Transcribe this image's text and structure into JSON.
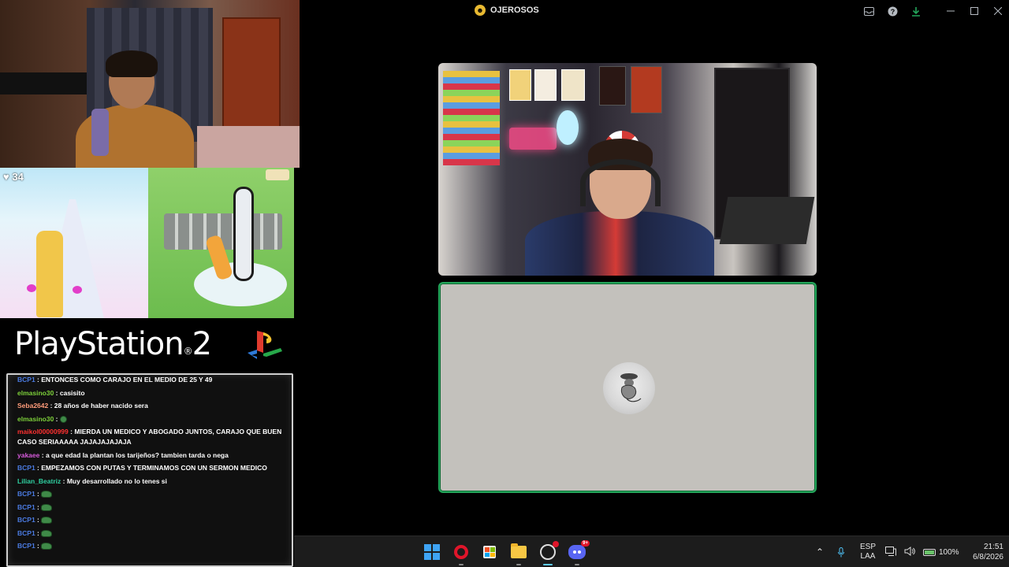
{
  "window": {
    "title": "OJEROSOS",
    "server_icon": "emoji-server-icon"
  },
  "titlebar_icons": [
    "inbox-icon",
    "help-icon",
    "download-icon",
    "minimize-icon",
    "maximize-icon",
    "close-icon"
  ],
  "overlay": {
    "game_score": "34",
    "ps2_logo": "PlayStation",
    "ps2_logo_suffix": "2"
  },
  "chat": {
    "messages": [
      {
        "user": "BCP1",
        "text": "ENTONCES COMO CARAJO EN EL MEDIO DE 25 Y 49",
        "color": "#4a7ae0"
      },
      {
        "user": "elmasino30",
        "text": "casisito",
        "color": "#7dd03a"
      },
      {
        "user": "Seba2642",
        "text": "28 años de haber nacido sera",
        "color": "#ff9c7a"
      },
      {
        "user": "elmasino30",
        "text": "",
        "color": "#7dd03a",
        "emote": "pepe-emote"
      },
      {
        "user": "maikol00000999",
        "text": "MIERDA UN MEDICO Y ABOGADO JUNTOS, CARAJO QUE BUEN CASO SERIAAAAA JAJAJAJAJAJA",
        "color": "#ff3030"
      },
      {
        "user": "yakaee",
        "text": "a que edad la plantan los tarijeños? tambien tarda o nega",
        "color": "#d45ad9"
      },
      {
        "user": "BCP1",
        "text": "EMPEZAMOS CON PUTAS Y TERMINAMOS CON UN SERMON MEDICO",
        "color": "#4a7ae0"
      },
      {
        "user": "Lilian_Beatriz",
        "text": "Muy desarrollado no lo tenes si",
        "color": "#2fd0a0"
      },
      {
        "user": "BCP1",
        "text": "",
        "color": "#4a7ae0",
        "emote": "frog-emote"
      },
      {
        "user": "BCP1",
        "text": "",
        "color": "#4a7ae0",
        "emote": "frog-emote"
      },
      {
        "user": "BCP1",
        "text": "",
        "color": "#4a7ae0",
        "emote": "frog-emote"
      },
      {
        "user": "BCP1",
        "text": "",
        "color": "#4a7ae0",
        "emote": "frog-emote"
      },
      {
        "user": "BCP1",
        "text": "",
        "color": "#4a7ae0",
        "emote": "frog-emote"
      }
    ]
  },
  "call": {
    "active_speaker_border": "#23a55a",
    "tile_bottom_bg": "#c3c1bc"
  },
  "taskbar": {
    "apps": [
      "windows-start-icon",
      "opera-icon",
      "store-icon",
      "file-explorer-icon",
      "obs-icon",
      "discord-icon"
    ],
    "discord_badge": "9+",
    "lang_line1": "ESP",
    "lang_line2": "LAA",
    "battery": "100%",
    "time": "21:51",
    "date": "6/8/2026"
  }
}
